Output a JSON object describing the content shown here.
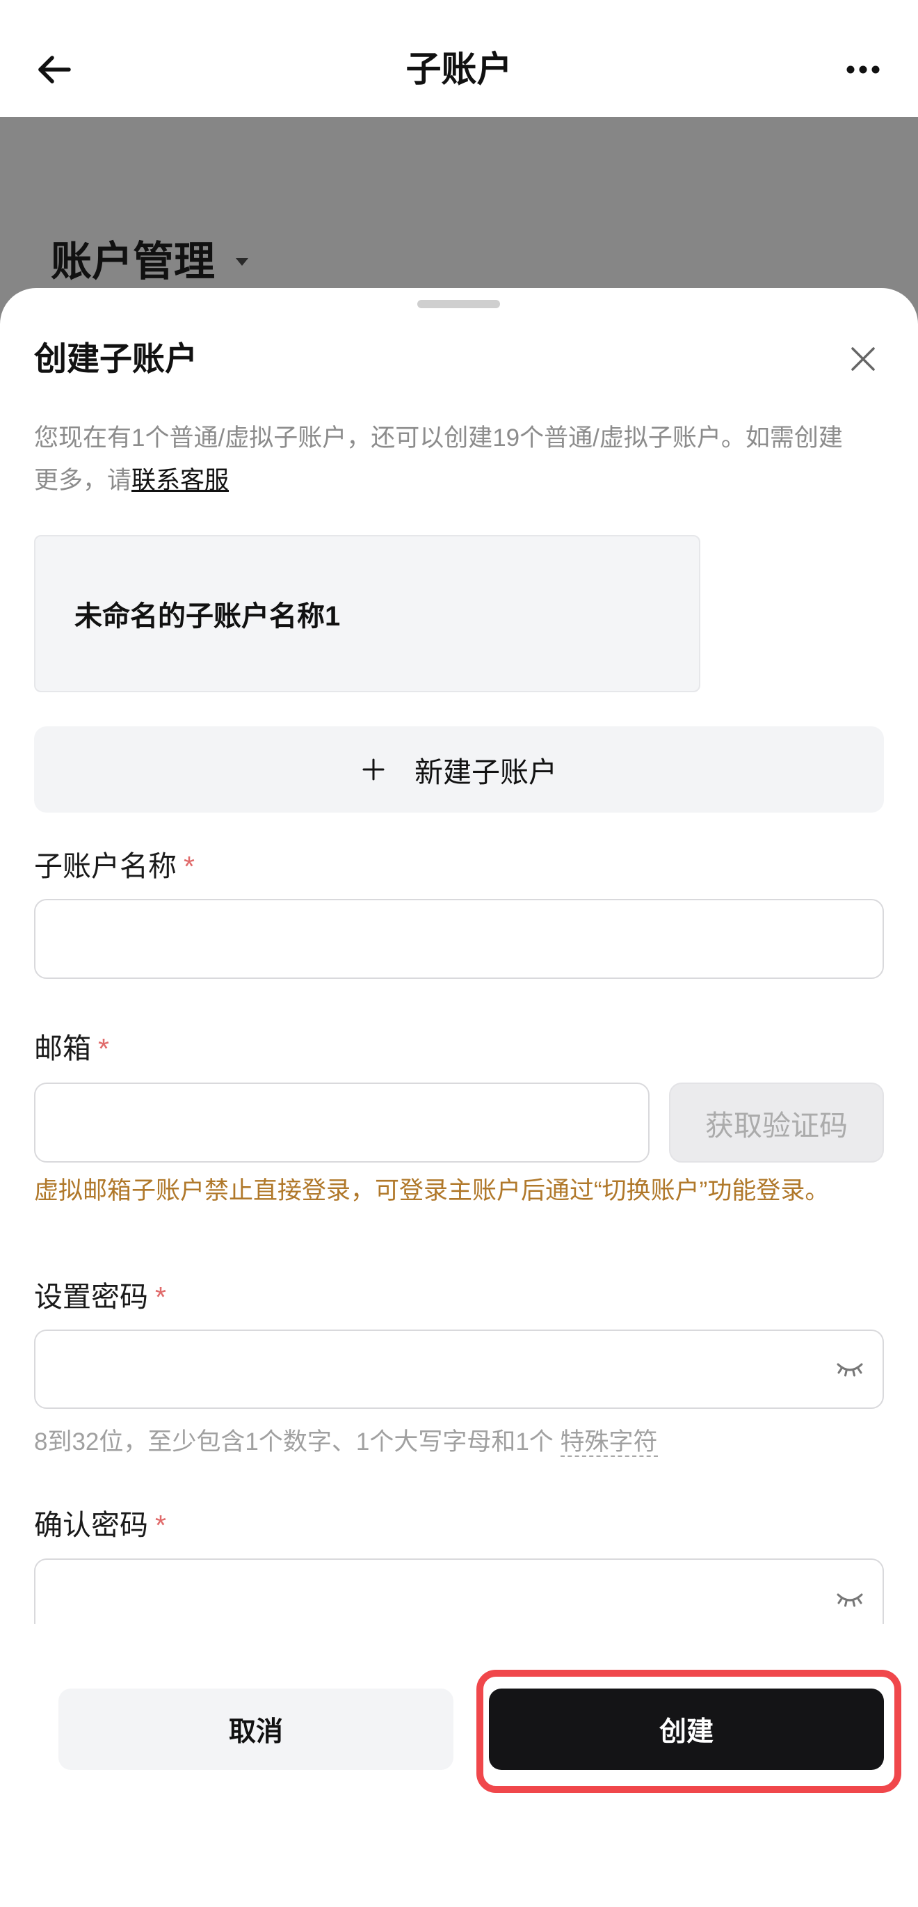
{
  "header": {
    "title": "子账户",
    "back_icon": "arrow-left-icon",
    "more_icon": "more-horizontal-icon"
  },
  "background_page": {
    "section_title": "账户管理",
    "dropdown_icon": "caret-down-icon"
  },
  "sheet": {
    "title": "创建子账户",
    "close_icon": "close-icon",
    "description": [
      "您现在有1个普通/虚拟子账户，还可以创建19个普通/虚拟子账户。如需创建",
      "更多，请"
    ],
    "contact_link": "联系客服",
    "subaccounts": [
      {
        "name": "未命名的子账户名称1"
      }
    ],
    "add_button": {
      "icon": "plus-icon",
      "label": "新建子账户"
    },
    "form": {
      "required_mark": "*",
      "name_label": "子账户名称",
      "name_value": "",
      "email_label": "邮箱",
      "email_value": "",
      "get_code_label": "获取验证码",
      "email_warning": "虚拟邮箱子账户禁止直接登录，可登录主账户后通过“切换账户”功能登录。",
      "password_label": "设置密码",
      "password_value": "",
      "password_hint": "8到32位，至少包含1个数字、1个大写字母和1个 ",
      "password_hint_link": "特殊字符",
      "confirm_label": "确认密码",
      "confirm_value": "",
      "visibility_icon": "eye-closed-icon"
    },
    "footer": {
      "cancel_label": "取消",
      "create_label": "创建"
    }
  },
  "colors": {
    "backdrop": "#868686",
    "primary_button": "#141416",
    "secondary_button": "#f3f4f6",
    "warning_text": "#b0782a",
    "required_mark": "#e06a6a",
    "muted_text": "#8c8c8c",
    "highlight": "#f0474b"
  }
}
